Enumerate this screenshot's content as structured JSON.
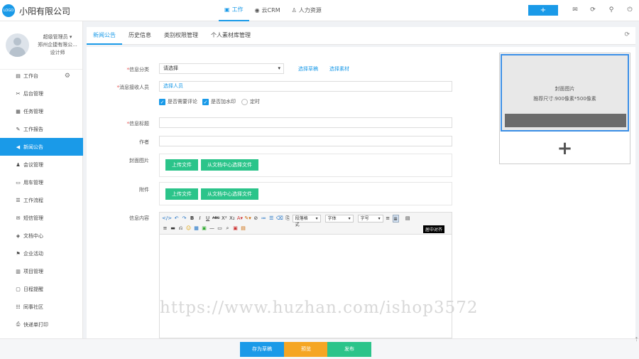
{
  "app": {
    "logo_text": "LOGO",
    "brand": "小阳有限公司",
    "accent": "#1a9ae8"
  },
  "topnav": [
    {
      "label": "工作",
      "icon": "briefcase-icon",
      "glyph": "▣"
    },
    {
      "label": "云CRM",
      "icon": "cloud-icon",
      "glyph": "◉"
    },
    {
      "label": "人力资源",
      "icon": "people-icon",
      "glyph": "♙"
    }
  ],
  "top_actions": {
    "plus_label": "+",
    "mail_icon": "✉",
    "refresh_icon": "⟳",
    "bulb_icon": "⚲",
    "power_icon": "⏻"
  },
  "profile": {
    "role": "超级管理员 ▾",
    "company": "郑州企捷有限公...",
    "title": "设计师"
  },
  "sidebar": {
    "gear_icon": "⚙",
    "items": [
      {
        "label": "工作台",
        "icon": "car-icon",
        "glyph": "▤"
      },
      {
        "label": "后台管理",
        "icon": "tools-icon",
        "glyph": "✂"
      },
      {
        "label": "任务管理",
        "icon": "task-icon",
        "glyph": "▦"
      },
      {
        "label": "工作报告",
        "icon": "edit-icon",
        "glyph": "✎"
      },
      {
        "label": "新闻公告",
        "icon": "megaphone-icon",
        "glyph": "◀"
      },
      {
        "label": "会议管理",
        "icon": "meeting-icon",
        "glyph": "♟"
      },
      {
        "label": "用车管理",
        "icon": "car-icon",
        "glyph": "▭"
      },
      {
        "label": "工作流程",
        "icon": "flow-icon",
        "glyph": "☰"
      },
      {
        "label": "短信管理",
        "icon": "sms-icon",
        "glyph": "✉"
      },
      {
        "label": "文档中心",
        "icon": "docs-icon",
        "glyph": "◈"
      },
      {
        "label": "企业活动",
        "icon": "flag-icon",
        "glyph": "⚑"
      },
      {
        "label": "项目管理",
        "icon": "project-icon",
        "glyph": "▥"
      },
      {
        "label": "日程提醒",
        "icon": "calendar-icon",
        "glyph": "▢"
      },
      {
        "label": "同事社区",
        "icon": "community-icon",
        "glyph": "☷"
      },
      {
        "label": "快递单打印",
        "icon": "print-icon",
        "glyph": "⎙"
      }
    ]
  },
  "tabs": [
    {
      "label": "新闻公告"
    },
    {
      "label": "历史信息"
    },
    {
      "label": "类别权限管理"
    },
    {
      "label": "个人素材库管理"
    }
  ],
  "tab_refresh_icon": "⟳",
  "form": {
    "category_label": "信息分类",
    "category_value": "请选择",
    "category_caret": "▾",
    "link_draft": "选择草稿",
    "link_material": "选择素材",
    "receivers_label": "消息接收人员",
    "receivers_value": "选择人员",
    "opt_comment": "是否需要评论",
    "opt_watermark": "是否加水印",
    "opt_timed": "定时",
    "title_label": "信息标题",
    "author_label": "作者",
    "cover_label": "封面图片",
    "attach_label": "附件",
    "upload_file": "上传文件",
    "from_doc_center": "从文档中心选择文件",
    "content_label": "信息内容"
  },
  "editor": {
    "row1": [
      "</>",
      "↶",
      "↷",
      "B",
      "I",
      "U",
      "ABC",
      "X²",
      "X₂",
      "A▾",
      "✎▾",
      "⊘",
      "≔",
      "☰",
      "⌫",
      "⎘"
    ],
    "paragraph_format": "段落格式",
    "font_family": "字体",
    "font_size": "字号",
    "row1_tail": [
      "≡",
      "≣",
      "▤"
    ],
    "row2": [
      "≡",
      "▬",
      "⎌",
      "☺",
      "▦",
      "▣",
      "—",
      "▭",
      "⌕",
      "▣",
      "▤"
    ],
    "tooltip": "居中对齐"
  },
  "preview": {
    "caption1": "封面图片",
    "caption2": "推荐尺寸:900像素*500像素",
    "add_label": "+"
  },
  "footer": {
    "save_draft": "存为草稿",
    "preview": "预览",
    "publish": "发布",
    "colors": {
      "save_draft": "#1a9ae8",
      "preview": "#f5a623",
      "publish": "#2bc48a"
    }
  },
  "watermark": "https://www.huzhan.com/ishop3572",
  "scroll_top_icon": "⇡"
}
